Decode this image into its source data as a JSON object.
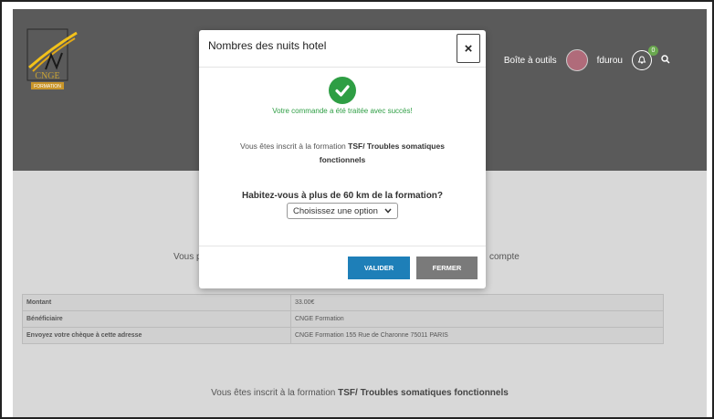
{
  "header": {
    "logo_text": "CNGE",
    "logo_sub": "FORMATION",
    "nav_tools": "Boîte à outils",
    "nav_user": "fdurou",
    "notif_count": "0"
  },
  "page": {
    "left_fragment": "Vous p",
    "right_fragment": "compte"
  },
  "info_rows": [
    {
      "label": "Montant",
      "value": "33.00€"
    },
    {
      "label": "Bénéficiaire",
      "value": "CNGE Formation"
    },
    {
      "label": "Envoyez votre chèque à cette adresse",
      "value": "CNGE Formation 155 Rue de Charonne 75011 PARIS"
    }
  ],
  "bottom": {
    "prefix": "Vous êtes inscrit à la formation ",
    "formation": "TSF/ Troubles somatiques fonctionnels"
  },
  "modal": {
    "title": "Nombres des nuits hotel",
    "close": "×",
    "success_message": "Votre commande a été traitée avec succès!",
    "enrolled_prefix": "Vous êtes inscrit à la formation ",
    "enrolled_formation": "TSF/ Troubles somatiques fonctionnels",
    "question": "Habitez-vous à plus de 60 km de la formation?",
    "select_value": "Choisissez une option",
    "valider_label": "VALIDER",
    "fermer_label": "FERMER"
  },
  "colors": {
    "header_bg": "#5a5a5a",
    "success": "#2e9e44",
    "primary": "#1e7fb8",
    "secondary": "#7a7a7a"
  },
  "icons": [
    "check-circle-icon",
    "bell-icon",
    "search-icon",
    "chevron-down-icon",
    "close-icon"
  ]
}
